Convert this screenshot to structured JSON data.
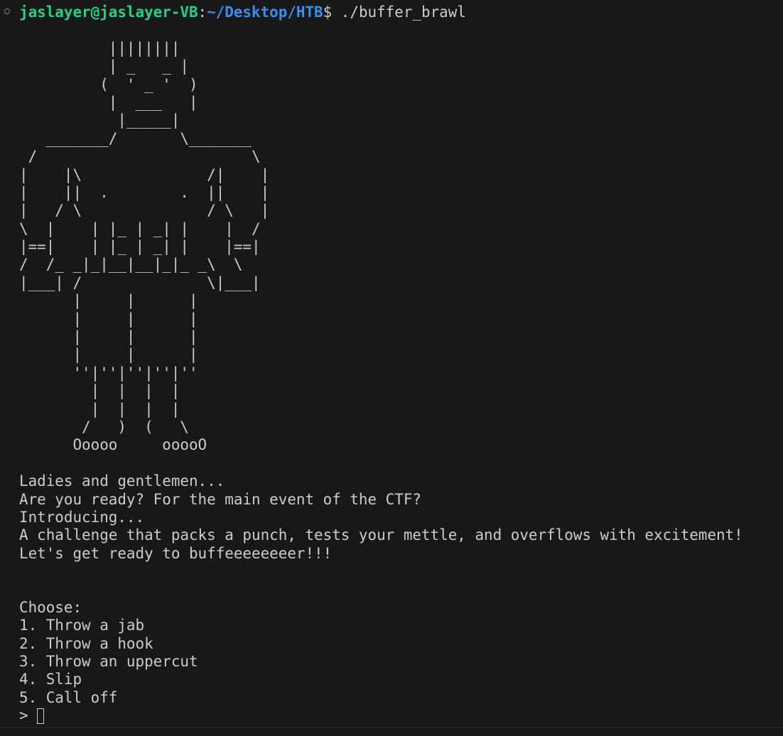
{
  "prompt": {
    "user_host": "jaslayer@jaslayer-VB",
    "colon": ":",
    "path": "~/Desktop/HTB",
    "symbol": "$ ",
    "command": "./buffer_brawl"
  },
  "ascii_art": [
    "          ||||||||",
    "          | _   _ |",
    "         (  ' _ '  )",
    "          |  ___   |",
    "           |_____|",
    "   _______/       \\_______",
    " /                        \\",
    "|    |\\              /|    |",
    "|    ||  .        .  ||    |",
    "|   / \\              / \\   |",
    "\\  |    | |_ | _| |    |  /",
    "|==|    | |_ | _| |    |==|",
    "/  /_ _|_|__|__|_|_ _\\  \\",
    "|___| /              \\|___|",
    "      |     |      |",
    "      |     |      |",
    "      |     |      |",
    "      |     |      |",
    "      ''|''|''|''|''",
    "        |  |  |  |",
    "        |  |  |  |",
    "       /   )  (   \\",
    "      Ooooo     ooooO"
  ],
  "intro_lines": [
    "Ladies and gentlemen...",
    "Are you ready? For the main event of the CTF?",
    "Introducing...",
    "A challenge that packs a punch, tests your mettle, and overflows with excitement!",
    "Let's get ready to buffeeeeeeeer!!!"
  ],
  "menu": {
    "heading": "Choose:",
    "options": [
      "1. Throw a jab",
      "2. Throw a hook",
      "3. Throw an uppercut",
      "4. Slip",
      "5. Call off"
    ],
    "input_prompt": ">"
  },
  "colors": {
    "background": "#181818",
    "text": "#cccccc",
    "user_host": "#23d18b",
    "path": "#3b8eea"
  }
}
